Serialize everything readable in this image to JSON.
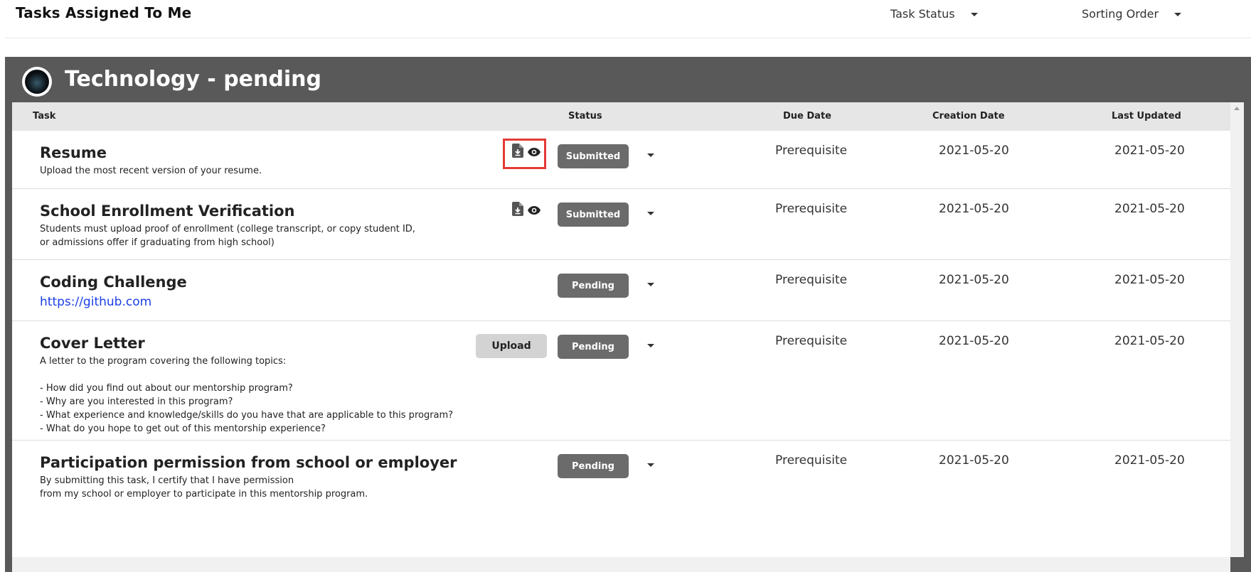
{
  "header": {
    "title": "Tasks Assigned To Me",
    "filters": [
      {
        "label": "Task Status"
      },
      {
        "label": "Sorting Order"
      }
    ]
  },
  "panel": {
    "title": "Technology - pending"
  },
  "table": {
    "columns": [
      "Task",
      "Status",
      "Due Date",
      "Creation Date",
      "Last Updated"
    ],
    "rows": [
      {
        "name": "Resume",
        "description": "Upload the most recent version of your resume.",
        "link": "",
        "status": "Submitted",
        "due": "Prerequisite",
        "created": "2021-05-20",
        "updated": "2021-05-20",
        "has_file_icons": true,
        "upload_label": ""
      },
      {
        "name": "School Enrollment Verification",
        "description": "Students must upload proof of enrollment (college transcript, or copy student ID,\nor admissions offer if graduating from high school)",
        "link": "",
        "status": "Submitted",
        "due": "Prerequisite",
        "created": "2021-05-20",
        "updated": "2021-05-20",
        "has_file_icons": true,
        "upload_label": ""
      },
      {
        "name": "Coding Challenge",
        "description": "",
        "link": "https://github.com",
        "status": "Pending",
        "due": "Prerequisite",
        "created": "2021-05-20",
        "updated": "2021-05-20",
        "has_file_icons": false,
        "upload_label": ""
      },
      {
        "name": "Cover Letter",
        "description": "A letter to the program covering the following topics:\n\n- How did you find out about our mentorship program?\n- Why are you interested in this program?\n- What experience and knowledge/skills do you have that are applicable to this program?\n- What do you hope to get out of this mentorship experience?",
        "link": "",
        "status": "Pending",
        "due": "Prerequisite",
        "created": "2021-05-20",
        "updated": "2021-05-20",
        "has_file_icons": false,
        "upload_label": "Upload"
      },
      {
        "name": "Participation permission from school or employer",
        "description": "By submitting this task, I certify that I have permission\nfrom my school or employer to participate in this mentorship program.",
        "link": "",
        "status": "Pending",
        "due": "Prerequisite",
        "created": "2021-05-20",
        "updated": "2021-05-20",
        "has_file_icons": false,
        "upload_label": ""
      }
    ]
  },
  "icons": {
    "download": "file-download-icon",
    "view": "eye-icon",
    "dropdown": "chevron-down-icon"
  },
  "colors": {
    "panel_bg": "#595959",
    "status_button": "#6b6b6b",
    "upload_button": "#d3d3d3",
    "link": "#1a3ee6",
    "highlight": "#e53935"
  }
}
